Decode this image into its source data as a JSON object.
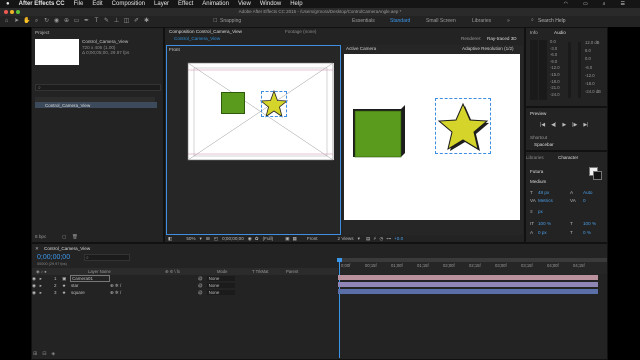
{
  "menu": {
    "app_name": "After Effects CC",
    "items": [
      "File",
      "Edit",
      "Composition",
      "Layer",
      "Effect",
      "Animation",
      "View",
      "Window",
      "Help"
    ]
  },
  "system": {
    "clock": ""
  },
  "window_title": "Adobe After Effects CC 2015 - /Users/grmora/Desktop/ControlCameraAngle.aep *",
  "toolbar": {
    "snapping": "Snapping",
    "workspaces": [
      "Essentials",
      "Standard",
      "Small Screen",
      "Libraries"
    ],
    "active_workspace": "Standard",
    "search": "Search Help"
  },
  "project": {
    "tab": "Project",
    "comp_name": "Control_Camera_View",
    "comp_info1": "720 x 406 (1.00)",
    "comp_info2": "Δ 0;00;05;00, 29.97 fps",
    "item": "Control_Camera_View",
    "bpc": "8 bpc"
  },
  "viewer": {
    "comp_tab": "Composition Control_Camera_View",
    "footage_tab": "Footage (none)",
    "breadcrumb": "Control_Camera_View",
    "renderer_label": "Renderer:",
    "renderer": "Ray-traced 3D",
    "left_view": "Front",
    "right_view": "Active Camera",
    "resolution": "Adaptive Resolution (1/2)",
    "zoom": "50%",
    "timecode": "0;00;00;00",
    "quality": "(Full)",
    "view_select": "Front",
    "views": "2 Views",
    "exposure": "+0.0"
  },
  "info_panel": {
    "tab_info": "Info",
    "tab_audio": "Audio",
    "db_left": [
      "0.0",
      "-3.0",
      "-6.0",
      "-9.0",
      "-12.0",
      "-15.0",
      "-18.0",
      "-21.0",
      "-24.0"
    ],
    "db_right": [
      "12.0 dB",
      "6.0",
      "0.0",
      "-6.0",
      "-12.0",
      "-18.0",
      "-24.0 dB"
    ]
  },
  "preview": {
    "tab": "Preview",
    "shortcut_label": "Shortcut",
    "shortcut": "Spacebar"
  },
  "character": {
    "tab_libraries": "Libraries",
    "tab_character": "Character",
    "font": "Futura",
    "style": "Medium",
    "size": "48 px",
    "leading": "Auto",
    "tracking_label": "Metrics",
    "tracking": "0",
    "stroke": "px",
    "scale_v": "100 %",
    "scale_h": "100 %",
    "baseline": "0 px",
    "tsume": "0 %"
  },
  "timeline": {
    "tab": "Control_Camera_View",
    "timecode": "0;00;00;00",
    "timecode_sub": "00000 (29.97 fps)",
    "col_layer": "Layer Name",
    "col_mode": "Mode",
    "col_trkmat": "T TrkMat",
    "col_parent": "Parent",
    "ticks": [
      "0;00f",
      "00;15f",
      "01;00f",
      "01;15f",
      "02;00f",
      "02;15f",
      "03;00f",
      "03;15f",
      "04;00f",
      "04;15f"
    ],
    "layers": [
      {
        "num": "1",
        "name": "Camera01",
        "parent": "None"
      },
      {
        "num": "2",
        "name": "star",
        "parent": "None"
      },
      {
        "num": "3",
        "name": "square",
        "parent": "None"
      }
    ],
    "bar_colors": [
      "#b9929d",
      "#8f86b6",
      "#5a6ea8"
    ]
  },
  "colors": {
    "accent": "#2d8ceb",
    "star": "#d4d42a",
    "square": "#5a9a1c"
  }
}
